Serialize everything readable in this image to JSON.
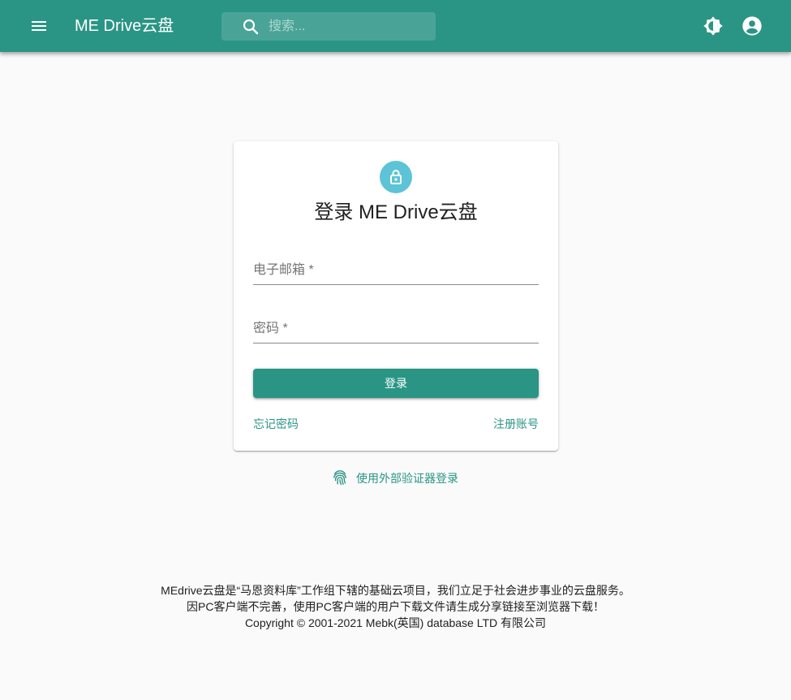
{
  "app": {
    "title": "ME Drive云盘"
  },
  "search": {
    "placeholder": "搜索..."
  },
  "header_icons": {
    "menu": "menu-icon",
    "theme": "brightness-icon",
    "account": "account-circle-icon"
  },
  "login": {
    "title": "登录 ME Drive云盘",
    "email_label": "电子邮箱 *",
    "email_value": "",
    "password_label": "密码 *",
    "password_value": "",
    "submit_label": "登录",
    "forgot_label": "忘记密码",
    "register_label": "注册账号",
    "lock_icon": "lock-icon"
  },
  "external_login": {
    "label": "使用外部验证器登录",
    "icon": "fingerprint-icon"
  },
  "footer": {
    "line1": "MEdrive云盘是“马恩资料库”工作组下辖的基础云项目，我们立足于社会进步事业的云盘服务。",
    "line2": "因PC客户端不完善，使用PC客户端的用户下载文件请生成分享链接至浏览器下载！",
    "line3": "Copyright © 2001-2021 Mebk(英国) database LTD 有限公司"
  },
  "colors": {
    "primary": "#2a9585",
    "avatar": "#5cc4d6",
    "background": "#fafafa"
  }
}
